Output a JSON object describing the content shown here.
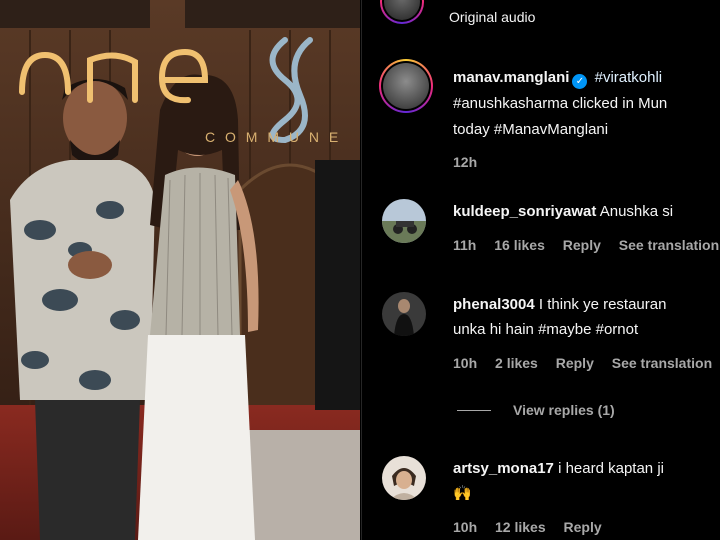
{
  "media": {
    "sign_text": "one8",
    "sign_subtext": "C O M M U N E"
  },
  "header": {
    "audio_label": "Original audio",
    "avatar_icon": "profile-avatar-icon"
  },
  "caption": {
    "username": "manav.manglani",
    "verified_icon": "verified-badge-icon",
    "line1_tag": "#viratkohli",
    "line2": "#anushkasharma clicked in Mun",
    "line3": "today #ManavManglani",
    "time": "12h"
  },
  "comments": [
    {
      "username": "kuldeep_sonriyawat",
      "text": "Anushka si",
      "time": "11h",
      "likes": "16 likes",
      "reply": "Reply",
      "translate": "See translation"
    },
    {
      "username": "phenal3004",
      "text": "I think ye restauran",
      "text2": "unka hi hain #maybe #ornot",
      "time": "10h",
      "likes": "2 likes",
      "reply": "Reply",
      "translate": "See translation"
    },
    {
      "username": "artsy_mona17",
      "text": "i heard kaptan ji",
      "text2": "🙌",
      "time": "10h",
      "likes": "12 likes",
      "reply": "Reply"
    }
  ],
  "view_replies": "View replies (1)",
  "colors": {
    "background": "#000000",
    "text": "#f5f5f5",
    "muted": "#a8a8a8",
    "verified": "#0095f6"
  }
}
